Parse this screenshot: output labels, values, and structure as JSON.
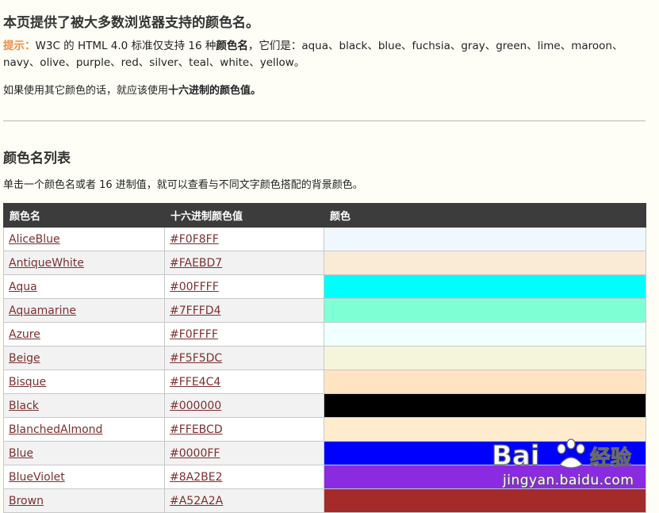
{
  "intro": {
    "heading": "本页提供了被大多数浏览器支持的颜色名。",
    "tip_label": "提示：",
    "tip_text_before": "W3C 的 HTML 4.0 标准仅支持 16 种",
    "tip_bold": "颜色名",
    "tip_text_after": "，它们是：aqua、black、blue、fuchsia、gray、green、lime、maroon、navy、olive、purple、red、silver、teal、white、yellow。",
    "para_before": "如果使用其它颜色的话，就应该使用",
    "para_bold": "十六进制的颜色值。"
  },
  "list": {
    "heading": "颜色名列表",
    "description": "单击一个颜色名或者 16 进制值，就可以查看与不同文字颜色搭配的背景颜色。"
  },
  "table": {
    "headers": [
      "颜色名",
      "十六进制颜色值",
      "颜色"
    ],
    "rows": [
      {
        "name": "AliceBlue",
        "hex": "#F0F8FF"
      },
      {
        "name": "AntiqueWhite",
        "hex": "#FAEBD7"
      },
      {
        "name": "Aqua",
        "hex": "#00FFFF"
      },
      {
        "name": "Aquamarine",
        "hex": "#7FFFD4"
      },
      {
        "name": "Azure",
        "hex": "#F0FFFF"
      },
      {
        "name": "Beige",
        "hex": "#F5F5DC"
      },
      {
        "name": "Bisque",
        "hex": "#FFE4C4"
      },
      {
        "name": "Black",
        "hex": "#000000"
      },
      {
        "name": "BlanchedAlmond",
        "hex": "#FFEBCD"
      },
      {
        "name": "Blue",
        "hex": "#0000FF"
      },
      {
        "name": "BlueViolet",
        "hex": "#8A2BE2"
      },
      {
        "name": "Brown",
        "hex": "#A52A2A"
      }
    ]
  },
  "watermark": {
    "brand": "Bai",
    "brand_suffix": "经验",
    "url": "jingyan.baidu.com"
  }
}
